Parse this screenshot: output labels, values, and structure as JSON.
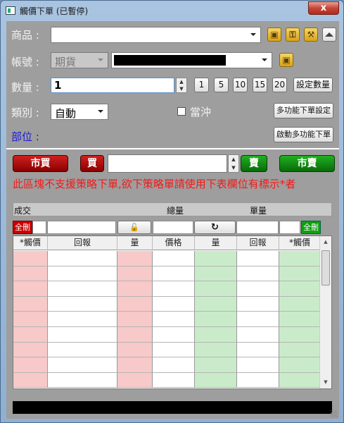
{
  "window": {
    "title": "觸價下單 (已暫停)",
    "close_symbol": "x"
  },
  "form": {
    "product_label": "商品 :",
    "account_label": "帳號 :",
    "account_type": "期貨",
    "quantity_label": "數量 :",
    "quantity_value": "1",
    "quick_qty": [
      "1",
      "5",
      "10",
      "15",
      "20"
    ],
    "set_qty_label": "設定數量",
    "type_label": "類別 :",
    "type_value": "自動",
    "daytrade_label": "當沖",
    "multi_order_setting_label": "多功能下單設定",
    "position_label": "部位 :",
    "activate_multi_label": "啟動多功能下單"
  },
  "order_bar": {
    "market_buy": "市買",
    "buy": "買",
    "sell": "賣",
    "market_sell": "市賣"
  },
  "warning_text": "此區塊不支援策略下單,欲下策略單請使用下表欄位有標示*者",
  "summary": {
    "filled_label": "成交",
    "total_label": "總量",
    "unit_label": "單量",
    "delete_all_buy": "全刪",
    "delete_all_sell": "全刪"
  },
  "grid": {
    "columns": [
      "*觸價",
      "回報",
      "量",
      "價格",
      "量",
      "回報",
      "*觸價"
    ]
  },
  "colors": {
    "buy": "#d02020",
    "sell": "#0f9f0f",
    "warning": "#f21a1a",
    "position": "#1b1bd8"
  }
}
